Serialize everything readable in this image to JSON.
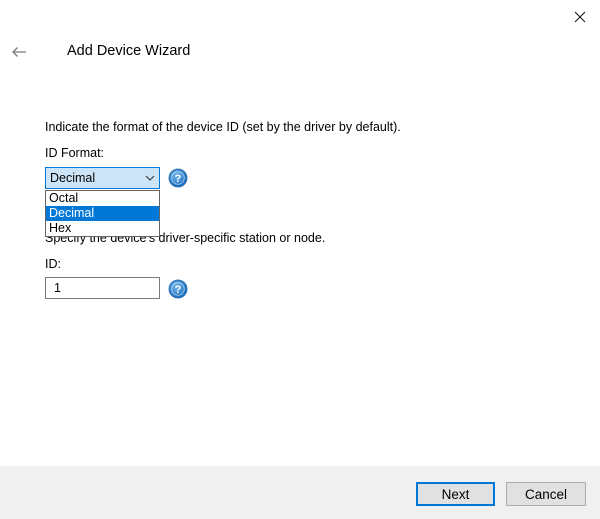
{
  "window": {
    "title": "Add Device Wizard",
    "close_icon": "close-icon",
    "back_icon": "back-arrow-icon"
  },
  "format_section": {
    "instruction": "Indicate the format of the device ID (set by the driver by default).",
    "label": "ID Format:",
    "selected_value": "Decimal",
    "options": [
      "Octal",
      "Decimal",
      "Hex"
    ],
    "selected_index": 1,
    "help_icon": "help-icon"
  },
  "id_section": {
    "instruction": "Specify the device's driver-specific station or node.",
    "label": "ID:",
    "value": "1",
    "help_icon": "help-icon"
  },
  "footer": {
    "next_label": "Next",
    "cancel_label": "Cancel"
  },
  "colors": {
    "accent": "#0078d7",
    "combo_background": "#cce4f7",
    "footer_background": "#f0f0f0",
    "button_background": "#e1e1e1",
    "help_icon_blue": "#1e78c8"
  }
}
